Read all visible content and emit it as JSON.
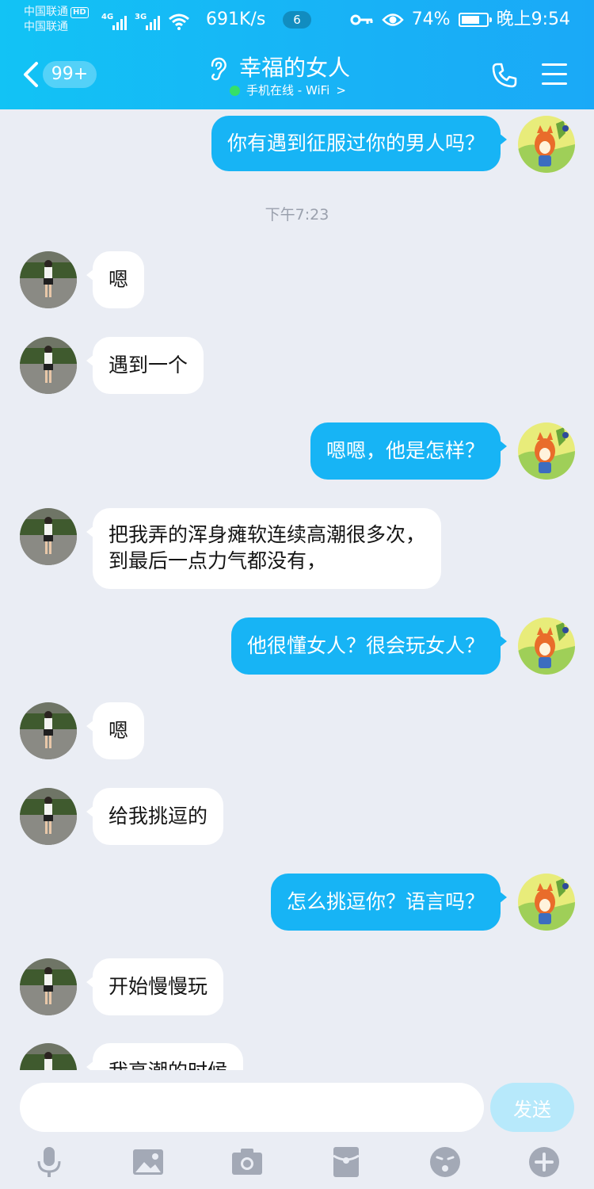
{
  "status_bar": {
    "carrier_1": "中国联通",
    "hd_badge": "HD",
    "carrier_2": "中国联通",
    "net_1": "4G",
    "net_2": "3G",
    "speed": "691K/s",
    "notification_count": "6",
    "battery": "74%",
    "battery_level": 0.74,
    "time": "晚上9:54"
  },
  "header": {
    "unread_count": "99+",
    "title": "幸福的女人",
    "status": "手机在线 - WiFi",
    "status_chevron": ">"
  },
  "messages": [
    {
      "side": "out",
      "text": "你有遇到征服过你的男人吗？"
    },
    {
      "type": "time",
      "text": "下午7:23"
    },
    {
      "side": "in",
      "text": "嗯"
    },
    {
      "side": "in",
      "text": "遇到一个"
    },
    {
      "side": "out",
      "text": "嗯嗯，他是怎样？"
    },
    {
      "side": "in",
      "text": "把我弄的浑身瘫软连续高潮很多次，",
      "text2": "到最后一点力气都没有，"
    },
    {
      "side": "out",
      "text": "他很懂女人？很会玩女人？"
    },
    {
      "side": "in",
      "text": "嗯"
    },
    {
      "side": "in",
      "text": "给我挑逗的"
    },
    {
      "side": "out",
      "text": "怎么挑逗你？语言吗？"
    },
    {
      "side": "in",
      "text": "开始慢慢玩"
    },
    {
      "side": "in",
      "text": "我高潮的时候"
    }
  ],
  "input": {
    "value": "",
    "send_label": "发送"
  },
  "toolbar": [
    "microphone-icon",
    "image-icon",
    "camera-icon",
    "red-packet-icon",
    "emoji-icon",
    "plus-icon"
  ],
  "colors": {
    "header": "#18b2f6",
    "bubble_out": "#17b4f5",
    "bubble_in": "#ffffff",
    "background": "#eaedf4",
    "send_disabled": "#b7e9fb"
  }
}
